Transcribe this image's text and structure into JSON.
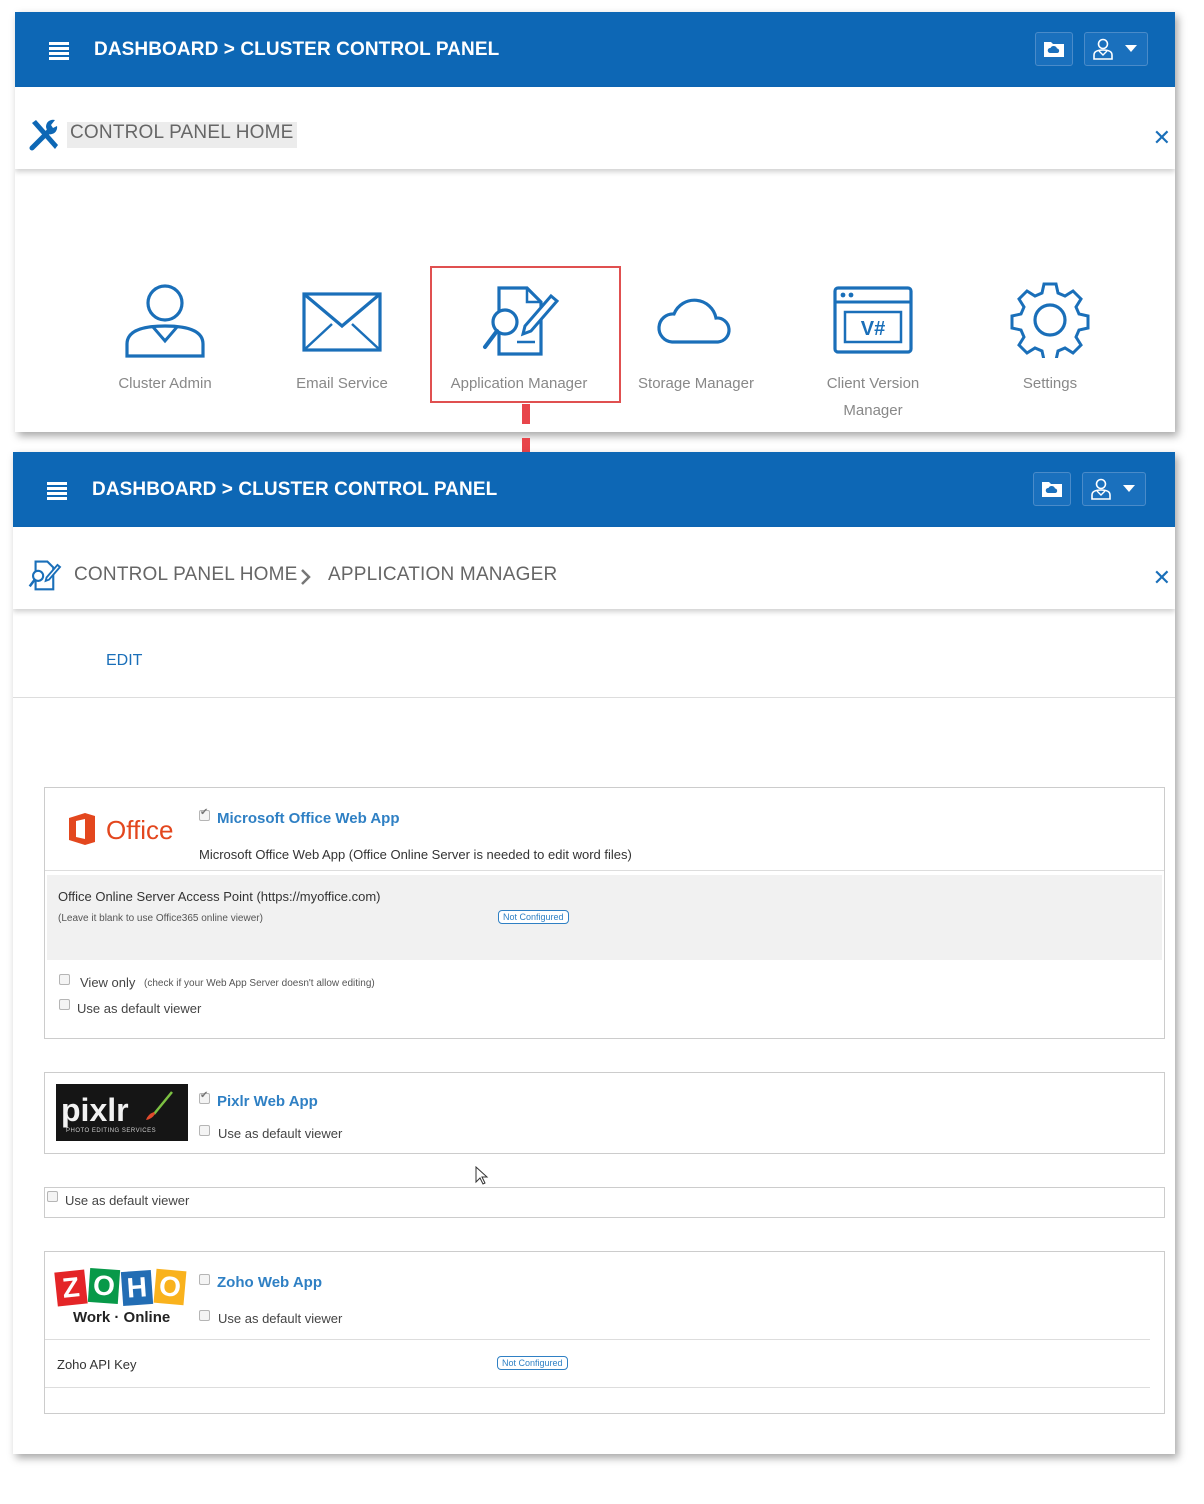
{
  "header": {
    "title": "DASHBOARD > CLUSTER CONTROL PANEL",
    "menu_icon": "hamburger-icon",
    "folder_icon": "cloud-folder-icon",
    "user_icon": "user-menu-icon"
  },
  "top_panel": {
    "breadcrumb": "CONTROL PANEL HOME",
    "tiles": [
      {
        "label": "Cluster Admin",
        "icon": "user-admin-icon"
      },
      {
        "label": "Email Service",
        "icon": "envelope-icon"
      },
      {
        "label": "Application Manager",
        "icon": "app-manager-icon"
      },
      {
        "label": "Storage Manager",
        "icon": "cloud-icon"
      },
      {
        "label": "Client Version Manager",
        "icon": "version-icon"
      },
      {
        "label": "Settings",
        "icon": "gear-icon"
      }
    ]
  },
  "bottom_panel": {
    "breadcrumb_home": "CONTROL PANEL HOME",
    "breadcrumb_current": "APPLICATION MANAGER",
    "edit_label": "EDIT",
    "office": {
      "logo_text": "Office",
      "title": "Microsoft Office Web App",
      "description": "Microsoft Office Web App (Office Online Server is needed to edit word files)",
      "access_point_label": "Office Online Server Access Point (https://myoffice.com)",
      "access_point_hint": "(Leave it blank to use Office365 online viewer)",
      "status": "Not Configured",
      "view_only_label": "View only",
      "view_only_hint": "(check if your Web App Server doesn't allow editing)",
      "default_viewer_label": "Use as default viewer"
    },
    "pixlr": {
      "logo_text": "pixlr",
      "logo_sub": "PHOTO EDITING SERVICES",
      "title": "Pixlr Web App",
      "default_viewer_label": "Use as default viewer"
    },
    "extra_default_viewer_label": "Use as default viewer",
    "zoho": {
      "logo_letters": [
        "Z",
        "O",
        "H",
        "O"
      ],
      "logo_sub": "Work · Online",
      "title": "Zoho Web App",
      "default_viewer_label": "Use as default viewer",
      "api_key_label": "Zoho API Key",
      "status": "Not Configured"
    }
  },
  "colors": {
    "brand": "#0d67b5",
    "link": "#2f80c4",
    "highlight": "#e05050",
    "office_orange": "#e3471e"
  }
}
